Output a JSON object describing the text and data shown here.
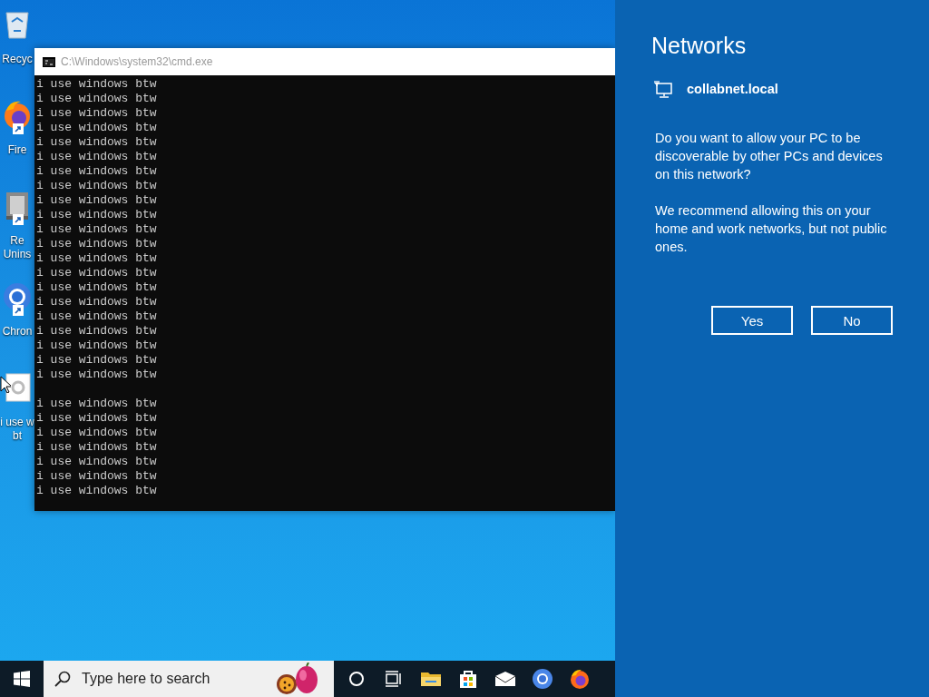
{
  "desktop_icons": [
    {
      "kind": "recycle",
      "label": [
        "Recyc"
      ],
      "shortcut": false
    },
    {
      "kind": "firefox",
      "label": [
        "Fire"
      ],
      "shortcut": true
    },
    {
      "kind": "app",
      "label": [
        "Re",
        "Unins"
      ],
      "shortcut": true
    },
    {
      "kind": "chrome",
      "label": [
        "Chron"
      ],
      "shortcut": true
    },
    {
      "kind": "file",
      "label": [
        "i use w",
        "bt"
      ],
      "shortcut": false
    }
  ],
  "console_window": {
    "title": "C:\\Windows\\system32\\cmd.exe",
    "blocks": [
      [
        "i use windows btw",
        "i use windows btw",
        "i use windows btw",
        "i use windows btw",
        "i use windows btw",
        "i use windows btw",
        "i use windows btw",
        "i use windows btw",
        "i use windows btw",
        "i use windows btw",
        "i use windows btw",
        "i use windows btw",
        "i use windows btw",
        "i use windows btw",
        "i use windows btw",
        "i use windows btw",
        "i use windows btw",
        "i use windows btw",
        "i use windows btw",
        "i use windows btw",
        "i use windows btw"
      ],
      [
        "i use windows btw",
        "i use windows btw",
        "i use windows btw",
        "i use windows btw",
        "i use windows btw",
        "i use windows btw",
        "i use windows btw"
      ]
    ]
  },
  "taskbar": {
    "search": {
      "placeholder": "Type here to search"
    },
    "apps": [
      {
        "kind": "cortana"
      },
      {
        "kind": "task-view"
      },
      {
        "kind": "folder"
      },
      {
        "kind": "store"
      },
      {
        "kind": "mail"
      },
      {
        "kind": "chrome"
      },
      {
        "kind": "firefox"
      }
    ]
  },
  "networks_panel": {
    "title": "Networks",
    "network": "collabnet.local",
    "paragraphs": [
      "Do you want to allow your PC to be discoverable by other PCs and devices on this network?",
      "We recommend allowing this on your home and work networks, but not public ones."
    ],
    "buttons": [
      "Yes",
      "No"
    ]
  }
}
